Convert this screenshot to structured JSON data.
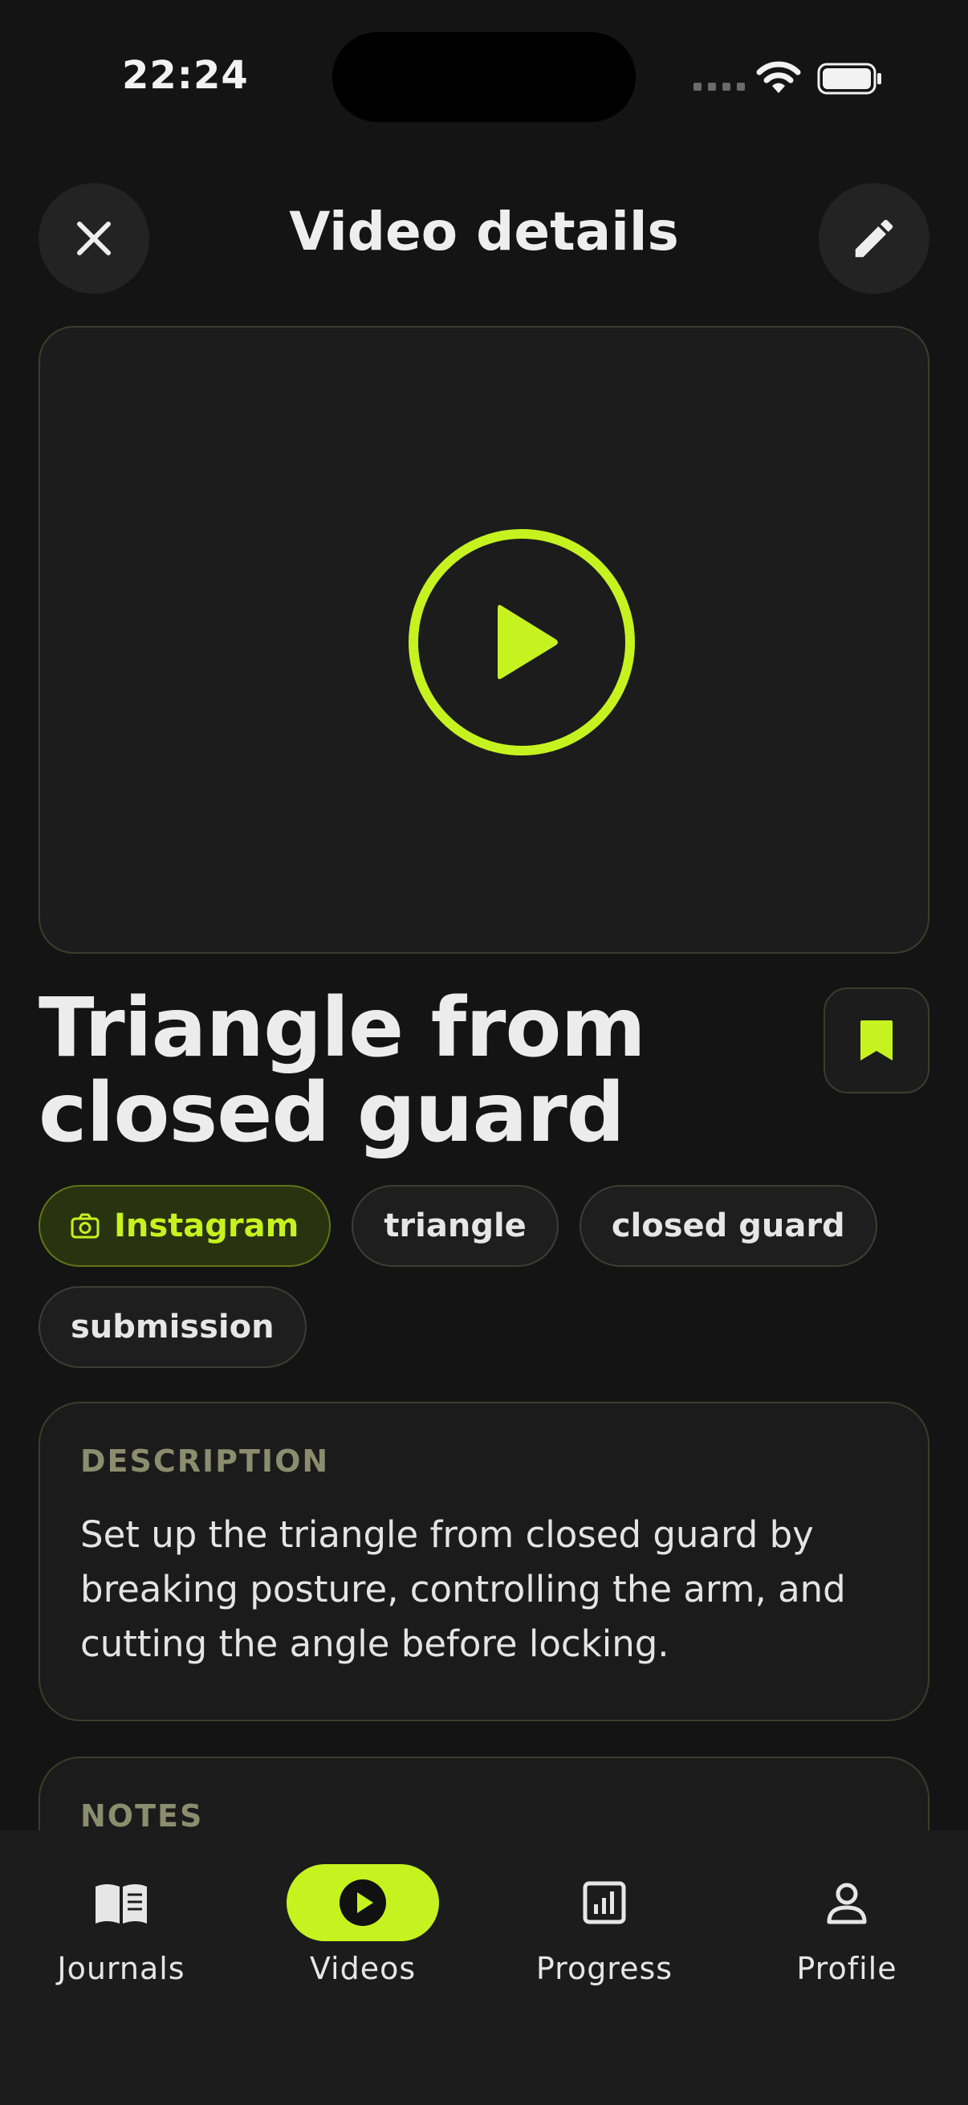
{
  "status_bar": {
    "time": "22:24"
  },
  "header": {
    "title": "Video details"
  },
  "video": {
    "title_line1": "Triangle from",
    "title_line2": "closed guard",
    "source_tag": "Instagram",
    "tags": [
      "triangle",
      "closed guard",
      "submission"
    ]
  },
  "description": {
    "label": "DESCRIPTION",
    "text": "Set up the triangle from closed guard by breaking posture, controlling the arm, and cutting the angle before locking."
  },
  "notes": {
    "label": "NOTES"
  },
  "nav": {
    "items": [
      {
        "label": "Journals",
        "icon": "book-icon"
      },
      {
        "label": "Videos",
        "icon": "play-circle-icon",
        "active": true
      },
      {
        "label": "Progress",
        "icon": "chart-icon"
      },
      {
        "label": "Profile",
        "icon": "person-icon"
      }
    ]
  },
  "colors": {
    "accent": "#c6f31f",
    "background": "#141414",
    "card": "#1b1b1b"
  }
}
